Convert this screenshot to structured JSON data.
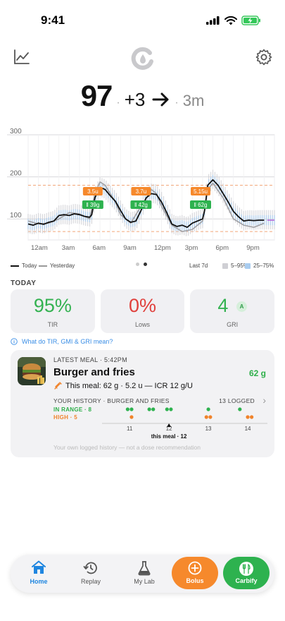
{
  "status_bar": {
    "time": "9:41"
  },
  "header": {
    "left_icon": "trend-chart-icon",
    "logo_icon": "carbify-logo-icon",
    "right_icon": "gear-icon"
  },
  "reading": {
    "value": "97",
    "delta": "+3",
    "trend_icon": "arrow-right-icon",
    "ago": "3m",
    "separator": "·"
  },
  "chart_data": {
    "type": "line",
    "x_tick_labels": [
      "12am",
      "3am",
      "6am",
      "9am",
      "12pm",
      "3pm",
      "6pm",
      "9pm"
    ],
    "y_tick_labels": [
      "100",
      "200",
      "300"
    ],
    "ylim": [
      50,
      300
    ],
    "series": [
      {
        "name": "Today",
        "x_hours": [
          0,
          0.5,
          1,
          1.5,
          2,
          2.5,
          3,
          3.5,
          4,
          4.5,
          5,
          5.5,
          6,
          6.2,
          6.5,
          7,
          7.5,
          8,
          8.5,
          9,
          9.5,
          10,
          10.5,
          11,
          11.5,
          12,
          12.5,
          13,
          13.5,
          14,
          14.5,
          15,
          15.5,
          16,
          16.5,
          17,
          17.2,
          17.5,
          18,
          18.5,
          19,
          19.5,
          20,
          20.5,
          21,
          21.5,
          22,
          22.5,
          23
        ],
        "y": [
          88,
          85,
          90,
          87,
          92,
          95,
          108,
          110,
          108,
          112,
          110,
          106,
          104,
          110,
          150,
          175,
          170,
          155,
          142,
          120,
          100,
          92,
          95,
          120,
          150,
          160,
          158,
          140,
          115,
          88,
          82,
          85,
          80,
          90,
          95,
          100,
          120,
          180,
          193,
          180,
          160,
          140,
          118,
          105,
          95,
          97,
          96,
          97,
          97
        ]
      },
      {
        "name": "Yesterday",
        "x_hours": [
          0,
          1,
          2,
          3,
          4,
          5,
          6,
          6.5,
          7,
          7.5,
          8,
          8.5,
          9,
          10,
          11,
          12,
          12.5,
          13,
          14,
          15,
          16,
          17,
          17.5,
          18,
          19,
          20,
          21,
          22,
          23
        ],
        "y": [
          95,
          88,
          90,
          100,
          115,
          112,
          100,
          160,
          188,
          180,
          160,
          140,
          110,
          90,
          130,
          170,
          160,
          130,
          85,
          70,
          75,
          95,
          170,
          185,
          150,
          100,
          85,
          80,
          90
        ]
      }
    ],
    "target_range": [
      70,
      180
    ],
    "meal_markers": [
      {
        "carbs": "39g",
        "dose": "3.5u",
        "hour": 6.3
      },
      {
        "carbs": "42g",
        "dose": "3.7u",
        "hour": 11.0
      },
      {
        "carbs": "62g",
        "dose": "5.15u",
        "hour": 16.8
      }
    ],
    "legend": [
      {
        "name": "Today"
      },
      {
        "name": "Yesterday"
      },
      {
        "name": "Last 7d"
      },
      {
        "name": "5–95%"
      },
      {
        "name": "25–75%"
      }
    ]
  },
  "legend": {
    "today": "Today",
    "yesterday": "Yesterday",
    "last7": "Last 7d",
    "p5_95": "5–95%",
    "p25_75": "25–75%"
  },
  "today": {
    "section_label": "TODAY",
    "stats": [
      {
        "value": "95%",
        "label": "TIR",
        "color": "#34b251"
      },
      {
        "value": "0%",
        "label": "Lows",
        "color": "#e0403c"
      },
      {
        "value": "4",
        "label": "GRI",
        "badge": "A",
        "color": "#34b251"
      }
    ],
    "info_link": "What do TIR, GMI & GRI mean?"
  },
  "latest_meal": {
    "kicker": "LATEST MEAL · 5:42PM",
    "title": "Burger and fries",
    "carbs": "62 g",
    "summary": "This meal: 62 g · 5.2 u — ICR 12 g/U",
    "history_label": "YOUR HISTORY · BURGER AND FRIES",
    "history_count": "13 LOGGED",
    "in_range_label": "IN RANGE · 8",
    "high_label": "HIGH · 5",
    "axis_ticks": [
      "11",
      "12",
      "13",
      "14"
    ],
    "this_meal_label": "this meal · 12",
    "footnote": "Your own logged history — not a dose recommendation"
  },
  "nav": {
    "items": [
      {
        "label": "Home",
        "icon": "home-icon"
      },
      {
        "label": "Replay",
        "icon": "history-icon"
      },
      {
        "label": "My Lab",
        "icon": "flask-icon"
      },
      {
        "label": "Bolus",
        "icon": "plus-circle-icon"
      },
      {
        "label": "Carbify",
        "icon": "utensils-icon"
      }
    ]
  },
  "colors": {
    "accent_blue": "#1f86e0",
    "green": "#34b251",
    "orange": "#f0832a",
    "red": "#e0403c"
  }
}
